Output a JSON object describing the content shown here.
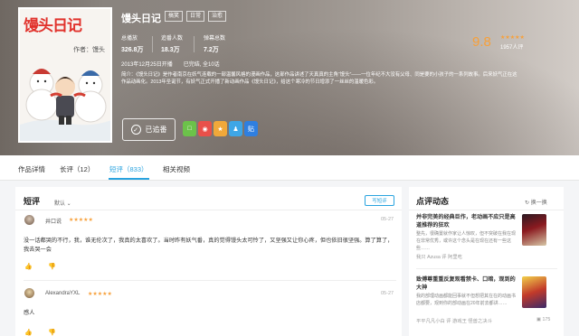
{
  "hero": {
    "cover_title": "馒头日记",
    "cover_sub": "作者：馒头",
    "title": "馒头日记",
    "tags": [
      "搞笑",
      "日常",
      "治愈"
    ],
    "stats": [
      {
        "label": "总播放",
        "value": "326.8万"
      },
      {
        "label": "追番人数",
        "value": "18.3万"
      },
      {
        "label": "弹幕总数",
        "value": "7.2万"
      }
    ],
    "score": "9.8",
    "score_stars": "★★★★★",
    "raters": "1957人评",
    "meta": "2013年12月25日开播　　已完结, 全10话",
    "intro": "简介：《馒头日记》是作者南京在妖气连载的一部温馨风格的漫画作品，这部作品讲述了天真真的主角“馒头”——一位年纪不大没有父母、同是要的小孩子的一系列故事。后来妖气正在这作品动画化。2013年圣诞节，有妖气正式开播了新动画作品《馒头日记》，给这个寒冷的节日增添了一丝丝的温暖色彩。",
    "follow_label": "已追番",
    "follow_check": "✓",
    "share_glyphs": [
      "□",
      "◉",
      "★",
      "♟",
      "贴"
    ],
    "colors": {
      "accent": "#29a3df",
      "score": "#f7a03a"
    }
  },
  "nav": {
    "tabs": [
      "作品详情",
      "长评（12）",
      "短评（833）",
      "相关视频"
    ]
  },
  "reviews": {
    "heading": "短评",
    "sort": "默认",
    "write_button": "写短评",
    "items": [
      {
        "user": "井口说",
        "stars": "★★★★★",
        "date": "05-27",
        "text": "没一话都哭的不行，我，谁无伦次了，我真的太喜欢了。当时昨有妖气番，真的觉得馒头太可怜了，又坚强又让你心疼，但也依旧很坚强。算了算了，我去哭一会",
        "like": "👍",
        "dislike": "👎"
      },
      {
        "user": "AlexandraYXL",
        "stars": "★★★★★",
        "date": "05-27",
        "text": "感人",
        "like": "👍",
        "dislike": "👎"
      }
    ]
  },
  "news": {
    "heading": "点评动态",
    "refresh": "换一换",
    "items": [
      {
        "title": "并非完美的经典巨作，老动画不应只是高道推荐的狂欢",
        "excerpt": "整先，很确置就作家让人惊叹，但不突破在我在现在非常优秀，或许这个念头是在现在还有一些这些……",
        "meta": "我只 Azusa 评 阿里吃"
      },
      {
        "title": "致傅尊重重反复观看禁卡、口暗，观到的大神",
        "excerpt": "我的部理动画都能回事就不但想把其在在的动画书店都要，观到你的部动画在20年前去都讲……",
        "meta": "平平凡凡小白 评 游戏王 怪兽之决斗",
        "count": "175"
      }
    ]
  }
}
